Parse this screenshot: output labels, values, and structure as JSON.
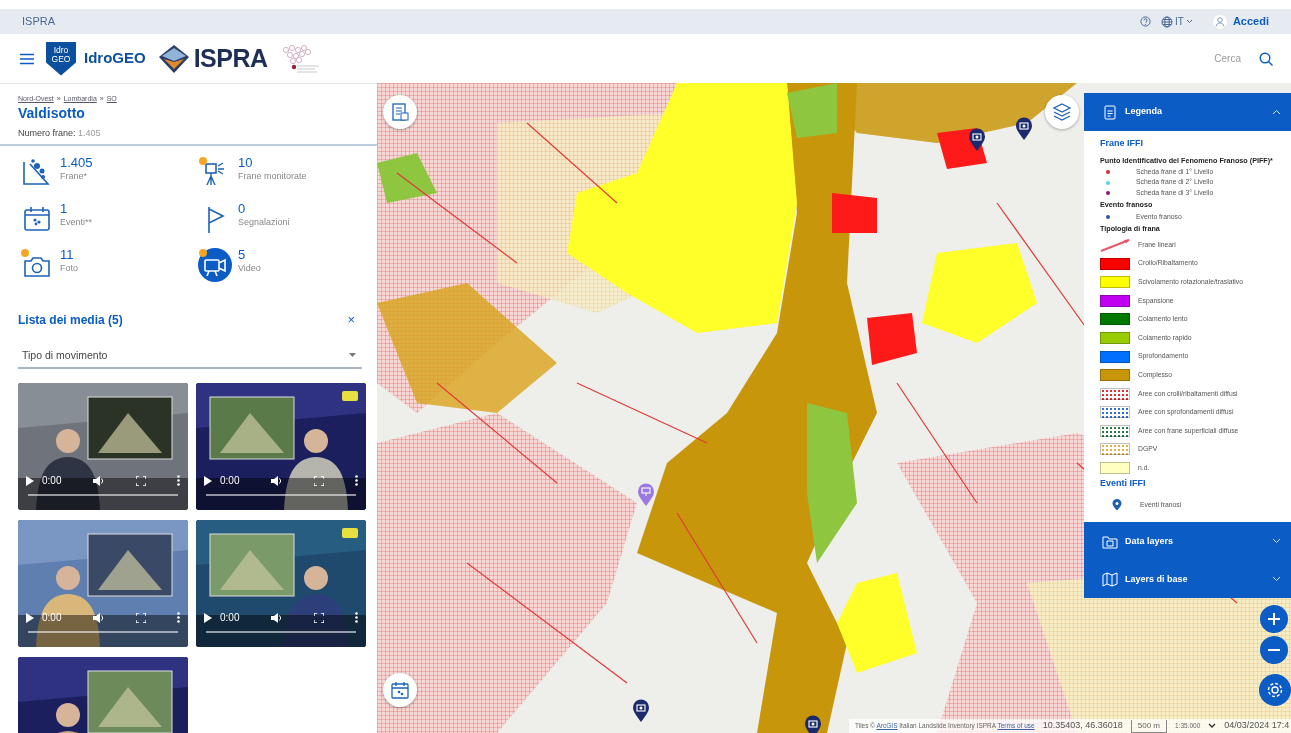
{
  "topbar": {
    "brand": "ISPRA",
    "language": "IT",
    "login": "Accedi"
  },
  "header": {
    "badge_lines": [
      "Idro",
      "GEO"
    ],
    "app_name": "IdroGEO",
    "logo_text": "ISPRA",
    "search_label": "Cerca"
  },
  "place": {
    "breadcrumb": [
      "Nord-Ovest",
      "Lombardia",
      "SO"
    ],
    "separator": "»",
    "title": "Valdisotto",
    "count_label": "Numero frane:",
    "count_value": "1.405"
  },
  "stats": [
    {
      "value": "1.405",
      "label": "Frane*",
      "kind": "landslide",
      "alert": false,
      "selected": false
    },
    {
      "value": "10",
      "label": "Frane monitorate",
      "kind": "monitoring",
      "alert": true,
      "selected": false
    },
    {
      "value": "1",
      "label": "Eventi**",
      "kind": "events",
      "alert": false,
      "selected": false
    },
    {
      "value": "0",
      "label": "Segnalazioni",
      "kind": "reports",
      "alert": false,
      "selected": false
    },
    {
      "value": "11",
      "label": "Foto",
      "kind": "photos",
      "alert": true,
      "selected": false
    },
    {
      "value": "5",
      "label": "Video",
      "kind": "videos",
      "alert": true,
      "selected": true
    }
  ],
  "media": {
    "title": "Lista dei media (5)",
    "close": "×",
    "filter_placeholder": "Tipo di movimento",
    "videos": [
      {
        "time": "0:00",
        "controls_visible": true
      },
      {
        "time": "0:00",
        "controls_visible": true
      },
      {
        "time": "0:00",
        "controls_visible": true
      },
      {
        "time": "0:00",
        "controls_visible": true
      },
      {
        "controls_visible": false
      }
    ]
  },
  "panels": [
    {
      "title": "Legenda",
      "kind": "legend",
      "expanded": true
    },
    {
      "title": "Data layers",
      "kind": "layers",
      "expanded": false
    },
    {
      "title": "Layers di base",
      "kind": "basemap",
      "expanded": false
    }
  ],
  "legend": {
    "sections": [
      {
        "title": "Frane IFFI",
        "groups": [
          {
            "heading": "Punto Identificativo del Fenomeno Franoso (PIFF)*",
            "items": [
              {
                "kind": "dot",
                "label": "Scheda frane di 1° Livello",
                "color": "#e3262b"
              },
              {
                "kind": "dot",
                "label": "Scheda frane di 2° Livello",
                "color": "#4fd6e8"
              },
              {
                "kind": "dot",
                "label": "Scheda frane di 3° Livello",
                "color": "#8a1a7a"
              }
            ]
          },
          {
            "heading": "Evento franoso",
            "items": [
              {
                "kind": "dot",
                "label": "Evento franoso",
                "color": "#2c5aa0"
              }
            ]
          },
          {
            "heading": "Tipologia di frana",
            "items": [
              {
                "kind": "line",
                "label": "Frane lineari",
                "color": "#e8566a"
              },
              {
                "kind": "fill",
                "label": "Crollo/Ribaltamento",
                "color": "#ff0000"
              },
              {
                "kind": "fill",
                "label": "Scivolamento rotazionale/traslativo",
                "color": "#ffff00"
              },
              {
                "kind": "fill",
                "label": "Espansione",
                "color": "#c000f0"
              },
              {
                "kind": "fill",
                "label": "Colamento lento",
                "color": "#007800"
              },
              {
                "kind": "fill",
                "label": "Colamento rapido",
                "color": "#99cc00"
              },
              {
                "kind": "fill",
                "label": "Sprofondamento",
                "color": "#0070ff"
              },
              {
                "kind": "fill",
                "label": "Complesso",
                "color": "#c8960a"
              },
              {
                "kind": "dotted",
                "label": "Aree con crolli/ribaltamenti diffusi",
                "color": "#e03030"
              },
              {
                "kind": "dotted",
                "label": "Aree con sprofondamenti diffusi",
                "color": "#3070e0"
              },
              {
                "kind": "dotted",
                "label": "Aree con frane superficiali diffuse",
                "color": "#208040"
              },
              {
                "kind": "dotted",
                "label": "DGPV",
                "color": "#e0b040"
              },
              {
                "kind": "fill",
                "label": "n.d.",
                "color": "#ffffc0"
              }
            ]
          }
        ]
      },
      {
        "title": "Eventi IFFI",
        "groups": [
          {
            "items": [
              {
                "kind": "pin",
                "label": "Eventi franosi",
                "color": "#1f5fb0"
              }
            ]
          }
        ]
      }
    ]
  },
  "map": {
    "attribution": {
      "prefix": "Tiles ©",
      "source_link": "ArcGIS",
      "text": "Italian Landslide Inventory ISPRA",
      "terms_link": "Terms of use"
    },
    "coordinates": "10.35403, 46.36018",
    "scale": "500 m",
    "ratio": "1:35.000",
    "timestamp": "04/03/2024 17:4"
  }
}
